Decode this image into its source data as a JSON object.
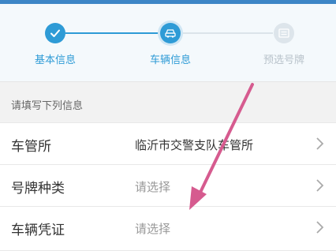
{
  "steps": [
    {
      "label": "基本信息",
      "state": "done",
      "icon": "check-icon"
    },
    {
      "label": "车辆信息",
      "state": "active",
      "icon": "car-icon"
    },
    {
      "label": "预选号牌",
      "state": "pending",
      "icon": "license-plate-icon"
    }
  ],
  "form": {
    "hint": "请填写下列信息",
    "rows": [
      {
        "label": "车管所",
        "value": "临沂市交警支队车管所"
      },
      {
        "label": "号牌种类",
        "value": "请选择"
      },
      {
        "label": "车辆凭证",
        "value": "请选择"
      }
    ]
  },
  "colors": {
    "accent": "#2e9bd6",
    "inactive": "#c9d4dc",
    "annotation_arrow": "#d65b8f"
  }
}
